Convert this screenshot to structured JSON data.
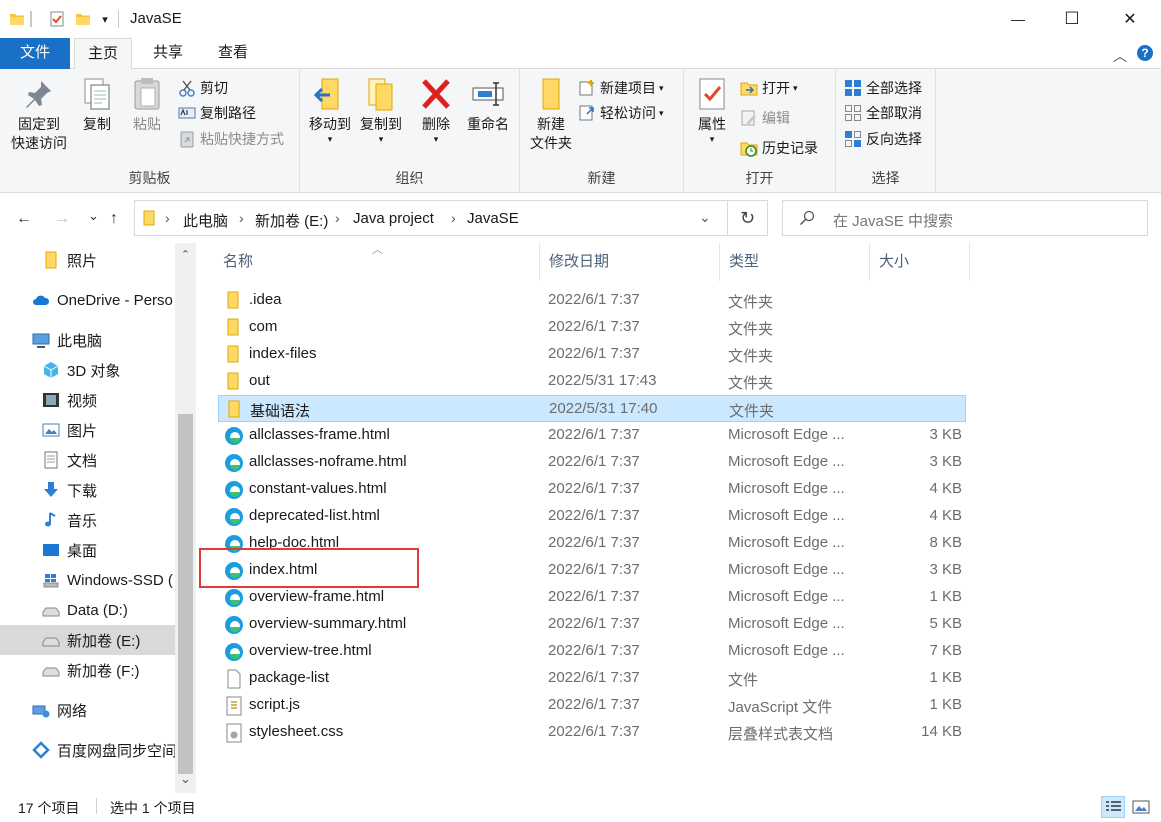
{
  "window": {
    "title": "JavaSE",
    "qa_dropdown": "▾",
    "minimize": "—",
    "maximize": "☐",
    "close": "✕"
  },
  "ribbon_tabs": [
    "文件",
    "主页",
    "共享",
    "查看"
  ],
  "ribbon_right": {
    "collapse": "︿",
    "help": "?"
  },
  "clipboard": {
    "pin_label_1": "固定到",
    "pin_label_2": "快速访问",
    "copy": "复制",
    "paste": "粘贴",
    "cut": "剪切",
    "copy_path": "复制路径",
    "paste_shortcut": "粘贴快捷方式",
    "group": "剪贴板"
  },
  "organize": {
    "move_to": "移动到",
    "copy_to": "复制到",
    "delete": "删除",
    "rename": "重命名",
    "group": "组织"
  },
  "new": {
    "new_folder_1": "新建",
    "new_folder_2": "文件夹",
    "new_item": "新建项目",
    "easy_access": "轻松访问",
    "group": "新建"
  },
  "open": {
    "properties": "属性",
    "open": "打开",
    "edit": "编辑",
    "history": "历史记录",
    "group": "打开"
  },
  "select": {
    "select_all": "全部选择",
    "select_none": "全部取消",
    "invert": "反向选择",
    "group": "选择"
  },
  "address": {
    "back": "←",
    "forward": "→",
    "recent": "⌄",
    "up": "↑",
    "breadcrumbs": [
      "此电脑",
      "新加卷 (E:)",
      "Java project",
      "JavaSE"
    ],
    "separator": "›",
    "dropdown": "⌄",
    "refresh": "↻",
    "search_placeholder": "在 JavaSE 中搜索"
  },
  "nav": {
    "items": [
      "照片",
      "OneDrive - Perso",
      "此电脑",
      "3D 对象",
      "视频",
      "图片",
      "文档",
      "下载",
      "音乐",
      "桌面",
      "Windows-SSD (",
      "Data (D:)",
      "新加卷 (E:)",
      "新加卷 (F:)",
      "网络",
      "百度网盘同步空间"
    ],
    "scroll_up": "⌃",
    "scroll_down": "⌄"
  },
  "columns": {
    "name": "名称",
    "date": "修改日期",
    "type": "类型",
    "size": "大小",
    "sort_indicator": "︿"
  },
  "files": [
    {
      "name": ".idea",
      "date": "2022/6/1 7:37",
      "type": "文件夹",
      "size": "",
      "icon": "folder-icon"
    },
    {
      "name": "com",
      "date": "2022/6/1 7:37",
      "type": "文件夹",
      "size": "",
      "icon": "folder-icon"
    },
    {
      "name": "index-files",
      "date": "2022/6/1 7:37",
      "type": "文件夹",
      "size": "",
      "icon": "folder-icon"
    },
    {
      "name": "out",
      "date": "2022/5/31 17:43",
      "type": "文件夹",
      "size": "",
      "icon": "folder-icon"
    },
    {
      "name": "基础语法",
      "date": "2022/5/31 17:40",
      "type": "文件夹",
      "size": "",
      "icon": "folder-icon",
      "selected": true
    },
    {
      "name": "allclasses-frame.html",
      "date": "2022/6/1 7:37",
      "type": "Microsoft Edge ...",
      "size": "3 KB",
      "icon": "edge-icon"
    },
    {
      "name": "allclasses-noframe.html",
      "date": "2022/6/1 7:37",
      "type": "Microsoft Edge ...",
      "size": "3 KB",
      "icon": "edge-icon"
    },
    {
      "name": "constant-values.html",
      "date": "2022/6/1 7:37",
      "type": "Microsoft Edge ...",
      "size": "4 KB",
      "icon": "edge-icon"
    },
    {
      "name": "deprecated-list.html",
      "date": "2022/6/1 7:37",
      "type": "Microsoft Edge ...",
      "size": "4 KB",
      "icon": "edge-icon"
    },
    {
      "name": "help-doc.html",
      "date": "2022/6/1 7:37",
      "type": "Microsoft Edge ...",
      "size": "8 KB",
      "icon": "edge-icon"
    },
    {
      "name": "index.html",
      "date": "2022/6/1 7:37",
      "type": "Microsoft Edge ...",
      "size": "3 KB",
      "icon": "edge-icon"
    },
    {
      "name": "overview-frame.html",
      "date": "2022/6/1 7:37",
      "type": "Microsoft Edge ...",
      "size": "1 KB",
      "icon": "edge-icon"
    },
    {
      "name": "overview-summary.html",
      "date": "2022/6/1 7:37",
      "type": "Microsoft Edge ...",
      "size": "5 KB",
      "icon": "edge-icon"
    },
    {
      "name": "overview-tree.html",
      "date": "2022/6/1 7:37",
      "type": "Microsoft Edge ...",
      "size": "7 KB",
      "icon": "edge-icon"
    },
    {
      "name": "package-list",
      "date": "2022/6/1 7:37",
      "type": "文件",
      "size": "1 KB",
      "icon": "file-icon"
    },
    {
      "name": "script.js",
      "date": "2022/6/1 7:37",
      "type": "JavaScript 文件",
      "size": "1 KB",
      "icon": "script-icon"
    },
    {
      "name": "stylesheet.css",
      "date": "2022/6/1 7:37",
      "type": "层叠样式表文档",
      "size": "14 KB",
      "icon": "css-icon"
    }
  ],
  "status": {
    "count": "17 个项目",
    "selected": "选中 1 个项目"
  },
  "colors": {
    "accent": "#1a6fc7",
    "selection": "#cce8ff",
    "selection_border": "#99d1ff",
    "highlight": "#e03a3a"
  }
}
